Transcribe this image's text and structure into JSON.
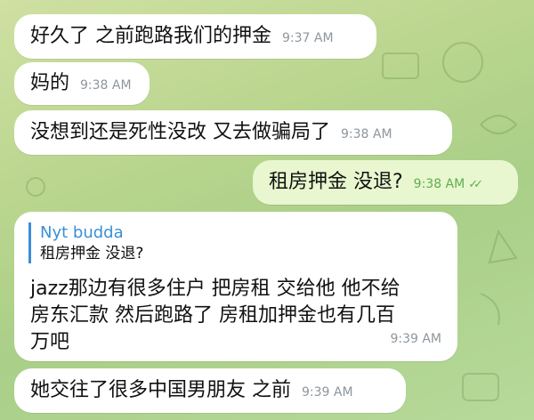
{
  "messages": [
    {
      "text": "好久了 之前跑路我们的押金",
      "time": "9:37 AM"
    },
    {
      "text": "妈的",
      "time": "9:38 AM"
    },
    {
      "text": "没想到还是死性没改 又去做骗局了",
      "time": "9:38 AM"
    },
    {
      "text": "租房押金 没退?",
      "time": "9:38 AM",
      "status_icon": "double-check-icon"
    },
    {
      "reply_name": "Nyt budda",
      "reply_text": "租房押金 没退?",
      "lines": [
        "jazz那边有很多住户 把房租 交给他 他不给",
        "房东汇款 然后跑路了 房租加押金也有几百",
        "万吧"
      ],
      "time": "9:39 AM"
    },
    {
      "text": "她交往了很多中国男朋友 之前",
      "time": "9:39 AM"
    }
  ],
  "colors": {
    "incoming_bubble": "#ffffff",
    "outgoing_bubble": "#e8f7cf",
    "reply_accent": "#3a8fd8",
    "read_ticks": "#5fae4f"
  }
}
